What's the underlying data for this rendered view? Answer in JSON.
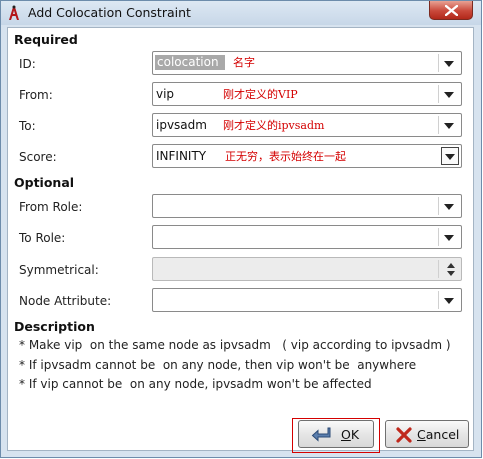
{
  "window": {
    "title": "Add Colocation Constraint"
  },
  "required": {
    "title": "Required",
    "fields": [
      {
        "label": "ID:",
        "value": "colocation",
        "note": "名字"
      },
      {
        "label": "From:",
        "value": "vip",
        "note": "刚才定义的VIP"
      },
      {
        "label": "To:",
        "value": "ipvsadm",
        "note": "刚才定义的ipvsadm"
      },
      {
        "label": "Score:",
        "value": "INFINITY",
        "note": "正无穷，表示始终在一起"
      }
    ]
  },
  "optional": {
    "title": "Optional",
    "fields": [
      {
        "label": "From Role:",
        "value": ""
      },
      {
        "label": "To Role:",
        "value": ""
      },
      {
        "label": "Symmetrical:",
        "value": ""
      },
      {
        "label": "Node Attribute:",
        "value": ""
      }
    ]
  },
  "description": {
    "title": "Description",
    "lines": [
      "* Make vip  on the same node as ipvsadm   ( vip according to ipvsadm )",
      "* If ipvsadm cannot be  on any node, then vip won't be  anywhere",
      "* If vip cannot be  on any node, ipvsadm won't be affected"
    ]
  },
  "buttons": {
    "ok_prefix": "",
    "ok_mnemonic": "O",
    "ok_rest": "K",
    "cancel_mnemonic": "C",
    "cancel_rest": "ancel"
  },
  "colors": {
    "annotation": "#d40000",
    "close_button": "#c9483a",
    "frame": "#d7e3ef"
  }
}
